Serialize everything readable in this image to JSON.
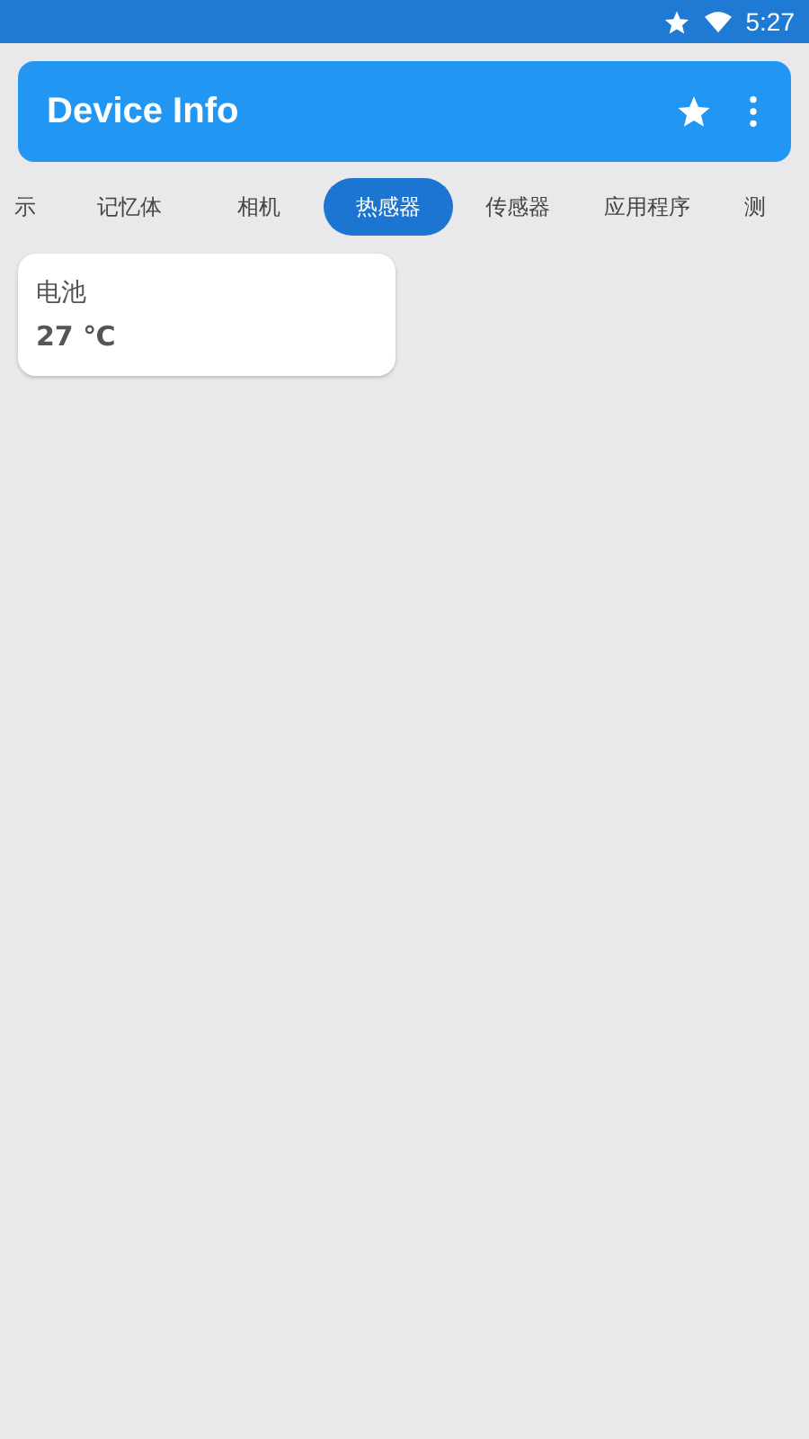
{
  "status_bar": {
    "time": "5:27"
  },
  "app_bar": {
    "title": "Device Info"
  },
  "tabs": [
    {
      "label": "示",
      "selected": false
    },
    {
      "label": "记忆体",
      "selected": false
    },
    {
      "label": "相机",
      "selected": false
    },
    {
      "label": "热感器",
      "selected": true
    },
    {
      "label": "传感器",
      "selected": false
    },
    {
      "label": "应用程序",
      "selected": false
    },
    {
      "label": "测",
      "selected": false
    }
  ],
  "cards": [
    {
      "name": "电池",
      "value": "27 ℃"
    }
  ]
}
